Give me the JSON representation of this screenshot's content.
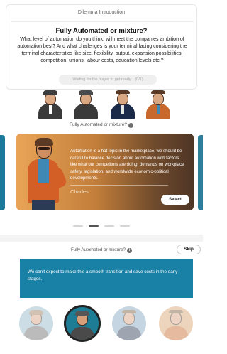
{
  "header": {
    "kicker": "Dilemma Introduction",
    "title": "Fully Automated or mixture?",
    "question": "What level of automation do you think, will meet the companies ambition of automation best? And what challenges is your terminal facing considering the terminal characteristics like size, flexibility, output, expansion possibilities, competition, unions, labour costs, education levels etc.?",
    "wait_label": "Waiting for the player to get ready... (0/1)"
  },
  "characters": [
    {
      "name": "character-1",
      "hat": "#3e3b3b",
      "body": "#3b3b3b"
    },
    {
      "name": "character-2",
      "hat": "#4a4a4a",
      "body": "#3a3a3a"
    },
    {
      "name": "character-3",
      "hat": "#5a3a24",
      "body": "#1c2a4a"
    },
    {
      "name": "character-4",
      "hat": "#5a3a24",
      "body": "#c9682d"
    }
  ],
  "carousel": {
    "caption": "Fully Automated or mixture?",
    "info_icon": "i",
    "card_text": "Automation is a hot topic in the marketplace, we should be careful to balance decision about automation with factors like what our competitors are doing, demands on workplace safety, legislation, and worldwide economic-political developments.",
    "author": "Charles",
    "select_label": "Select",
    "pages": 4,
    "active_page": 2
  },
  "answer_section": {
    "caption": "Fully Automated or mixture?",
    "info_icon": "i",
    "skip_label": "Skip",
    "answer_text": "We can't expect to make this a smooth transition and save costs in the early stages.",
    "accent_color": "#1a81a6"
  },
  "bubbles": [
    {
      "name": "bubble-1",
      "selected": false
    },
    {
      "name": "bubble-2",
      "selected": true
    },
    {
      "name": "bubble-3",
      "selected": false
    },
    {
      "name": "bubble-4",
      "selected": false
    }
  ]
}
